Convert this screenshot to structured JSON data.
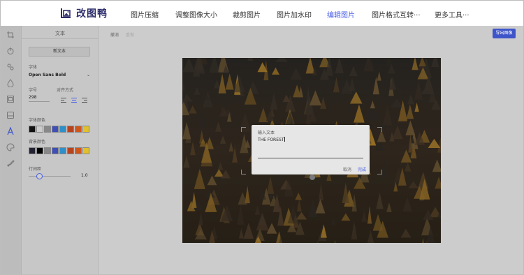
{
  "app": {
    "logo_text": "改图鸭"
  },
  "nav": {
    "items": [
      {
        "label": "图片压缩",
        "active": false
      },
      {
        "label": "调整图像大小",
        "active": false
      },
      {
        "label": "裁剪图片",
        "active": false
      },
      {
        "label": "图片加水印",
        "active": false
      },
      {
        "label": "编辑图片",
        "active": true
      },
      {
        "label": "图片格式互转···",
        "active": false
      },
      {
        "label": "更多工具···",
        "active": false
      }
    ]
  },
  "iconbar": {
    "icons": [
      "crop-icon",
      "power-icon",
      "adjust-icon",
      "drop-icon",
      "frame-icon",
      "sticker-icon",
      "text-icon",
      "palette-icon",
      "brush-icon"
    ]
  },
  "panel": {
    "title": "文本",
    "new_text_button": "新文本",
    "font_label": "字体",
    "font_value": "Open Sans Bold",
    "size_label": "字号",
    "size_value": "298",
    "align_label": "对齐方式",
    "font_color_label": "字体颜色",
    "font_colors": [
      "#111111",
      "#cccccc",
      "#888888",
      "#3f4fb7",
      "#2f8fc9",
      "#b8431f",
      "#d0571c",
      "#e1c12b"
    ],
    "bg_color_label": "背景颜色",
    "bg_colors": [
      "#222233",
      "#000000",
      "#888888",
      "#3f4fb7",
      "#2f8fc9",
      "#b8431f",
      "#d0571c",
      "#e1c12b"
    ],
    "line_height_label": "行间距",
    "line_height_value": "1.0",
    "line_height_level": 0.25
  },
  "toolbar": {
    "undo_label": "撤消",
    "redo_label": "重做",
    "export_label": "导出图像"
  },
  "dialog": {
    "title": "输入文本",
    "input_value": "THE FOREST",
    "cancel_label": "取消",
    "done_label": "完成"
  }
}
